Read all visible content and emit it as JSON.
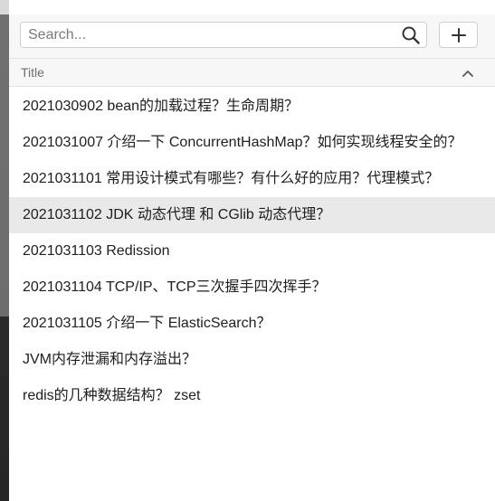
{
  "search": {
    "placeholder": "Search...",
    "value": ""
  },
  "icons": {
    "search": "search-icon",
    "add": "plus-icon",
    "sort": "chevron-up-icon"
  },
  "colors": {
    "selected_row": "#e9e9e9",
    "toolbar_bg": "#f7f7f7"
  },
  "table": {
    "column_title": "Title",
    "sort_direction": "ascending",
    "selected_index": 3,
    "rows": [
      "2021030902 bean的加载过程？生命周期？",
      "2021031007 介绍一下 ConcurrentHashMap？如何实现线程安全的？",
      "2021031101 常用设计模式有哪些？有什么好的应用？代理模式？",
      "2021031102 JDK 动态代理 和 CGlib 动态代理？",
      "2021031103 Redission",
      "2021031104 TCP/IP、TCP三次握手四次挥手？",
      "2021031105 介绍一下 ElasticSearch？",
      "JVM内存泄漏和内存溢出？",
      "redis的几种数据结构？ zset"
    ]
  }
}
